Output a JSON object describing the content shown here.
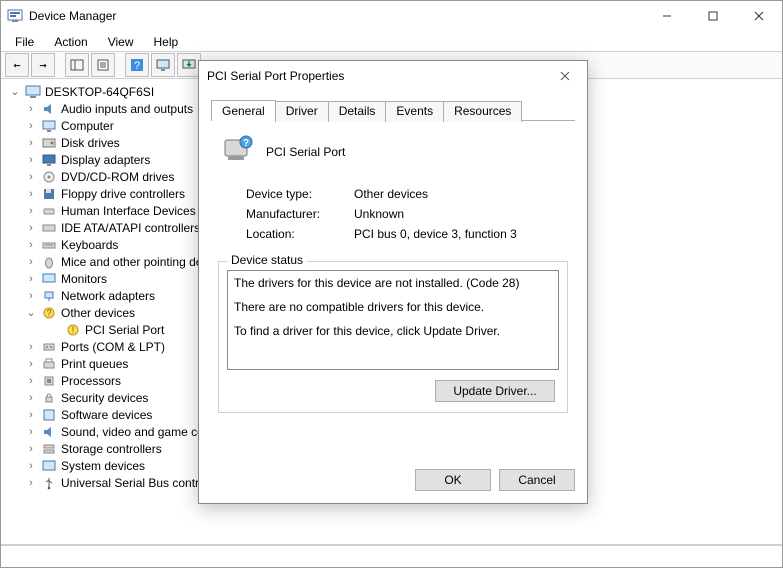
{
  "window": {
    "title": "Device Manager"
  },
  "menu": {
    "file": "File",
    "action": "Action",
    "view": "View",
    "help": "Help"
  },
  "tree": {
    "root": "DESKTOP-64QF6SI",
    "items": [
      "Audio inputs and outputs",
      "Computer",
      "Disk drives",
      "Display adapters",
      "DVD/CD-ROM drives",
      "Floppy drive controllers",
      "Human Interface Devices",
      "IDE ATA/ATAPI controllers",
      "Keyboards",
      "Mice and other pointing devices",
      "Monitors",
      "Network adapters",
      "Other devices",
      "Ports (COM & LPT)",
      "Print queues",
      "Processors",
      "Security devices",
      "Software devices",
      "Sound, video and game controllers",
      "Storage controllers",
      "System devices",
      "Universal Serial Bus controllers"
    ],
    "other_child": "PCI Serial Port"
  },
  "dialog": {
    "title": "PCI Serial Port Properties",
    "tabs": {
      "general": "General",
      "driver": "Driver",
      "details": "Details",
      "events": "Events",
      "resources": "Resources"
    },
    "device_name": "PCI Serial Port",
    "labels": {
      "device_type": "Device type:",
      "manufacturer": "Manufacturer:",
      "location": "Location:",
      "status_legend": "Device status"
    },
    "values": {
      "device_type": "Other devices",
      "manufacturer": "Unknown",
      "location": "PCI bus 0, device 3, function 3"
    },
    "status_lines": [
      "The drivers for this device are not installed. (Code 28)",
      "There are no compatible drivers for this device.",
      "To find a driver for this device, click Update Driver."
    ],
    "buttons": {
      "update": "Update Driver...",
      "ok": "OK",
      "cancel": "Cancel"
    }
  }
}
